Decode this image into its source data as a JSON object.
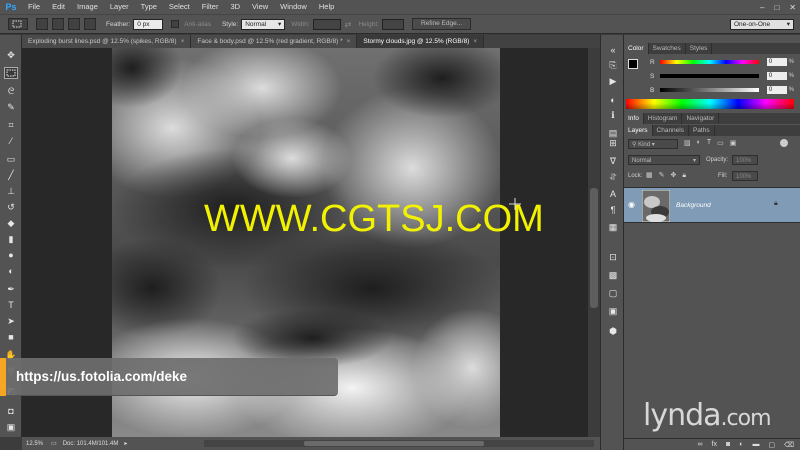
{
  "app": {
    "logo": "Ps",
    "menu": [
      "File",
      "Edit",
      "Image",
      "Layer",
      "Type",
      "Select",
      "Filter",
      "3D",
      "View",
      "Window",
      "Help"
    ],
    "window_controls": [
      "–",
      "□",
      "✕"
    ]
  },
  "options_bar": {
    "feather_label": "Feather:",
    "feather_value": "0 px",
    "antialias_label": "Anti-alias",
    "style_label": "Style:",
    "style_value": "Normal",
    "width_label": "Width:",
    "height_label": "Height:",
    "refine_edge_label": "Refine Edge...",
    "workspace_value": "One-on-One"
  },
  "tabs": [
    {
      "label": "Exploding burst lines.psd @ 12.5% (spikes, RGB/8)",
      "close": "×",
      "active": false
    },
    {
      "label": "Face & body.psd @ 12.5% (red gradient, RGB/8) *",
      "close": "×",
      "active": false
    },
    {
      "label": "Stormy clouds.jpg @ 12.5% (RGB/8)",
      "close": "×",
      "active": true
    }
  ],
  "status": {
    "zoom": "12.5%",
    "doc_info": "Doc: 101.4M/101.4M"
  },
  "color_panel": {
    "tabs": [
      "Color",
      "Swatches",
      "Styles"
    ],
    "rows": [
      {
        "label": "R",
        "value": "0",
        "unit": "%"
      },
      {
        "label": "S",
        "value": "0",
        "unit": "%"
      },
      {
        "label": "B",
        "value": "0",
        "unit": "%"
      }
    ]
  },
  "info_panel": {
    "tabs": [
      "Info",
      "Histogram",
      "Navigator"
    ]
  },
  "layers_panel": {
    "tabs": [
      "Layers",
      "Channels",
      "Paths"
    ],
    "kind_label": "Kind",
    "blend_mode": "Normal",
    "opacity_label": "Opacity:",
    "opacity_value": "100%",
    "lock_label": "Lock:",
    "fill_label": "Fill:",
    "fill_value": "100%",
    "layers": [
      {
        "name": "Background",
        "visible": true,
        "locked": true
      }
    ],
    "footer_icons": [
      "link-icon",
      "fx-icon",
      "mask-icon",
      "adjustment-icon",
      "group-icon",
      "new-layer-icon",
      "trash-icon"
    ]
  },
  "overlays": {
    "watermark": "WWW.CGTSJ.COM",
    "url": "https://us.fotolia.com/deke",
    "brand": "lynda",
    "brand_suffix": ".com"
  },
  "colors": {
    "ui_dark": "#535353",
    "canvas_bg": "#282828",
    "watermark": "#f2f200",
    "accent": "#f5a623",
    "selected_layer": "#7f9bb5"
  }
}
